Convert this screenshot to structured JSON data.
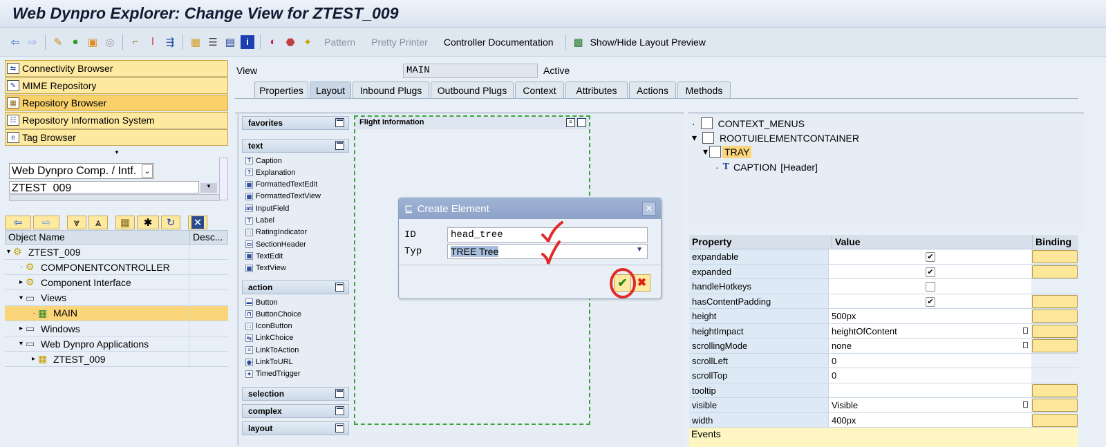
{
  "window": {
    "title": "Web Dynpro Explorer: Change View for ZTEST_009"
  },
  "toolbar": {
    "pattern": "Pattern",
    "pretty_printer": "Pretty Printer",
    "controller_doc": "Controller Documentation",
    "layout_preview": "Show/Hide Layout Preview"
  },
  "nav": {
    "items": [
      "Connectivity Browser",
      "MIME Repository",
      "Repository Browser",
      "Repository Information System",
      "Tag Browser"
    ]
  },
  "object_select": {
    "type": "Web Dynpro Comp. / Intf.",
    "name": "ZTEST_009"
  },
  "tree": {
    "col_name": "Object Name",
    "col_desc": "Desc...",
    "rows": [
      {
        "label": "ZTEST_009",
        "level": 0
      },
      {
        "label": "COMPONENTCONTROLLER",
        "level": 1
      },
      {
        "label": "Component Interface",
        "level": 1
      },
      {
        "label": "Views",
        "level": 1
      },
      {
        "label": "MAIN",
        "level": 2
      },
      {
        "label": "Windows",
        "level": 1
      },
      {
        "label": "Web Dynpro Applications",
        "level": 1
      },
      {
        "label": "ZTEST_009",
        "level": 2
      }
    ]
  },
  "view": {
    "label": "View",
    "name": "MAIN",
    "status": "Active"
  },
  "tabs": [
    "Properties",
    "Layout",
    "Inbound Plugs",
    "Outbound Plugs",
    "Context",
    "Attributes",
    "Actions",
    "Methods"
  ],
  "palette": {
    "groups": {
      "favorites": "favorites",
      "text": "text",
      "action": "action",
      "selection": "selection",
      "complex": "complex",
      "layout": "layout"
    },
    "text_items": [
      "Caption",
      "Explanation",
      "FormattedTextEdit",
      "FormattedTextView",
      "InputField",
      "Label",
      "RatingIndicator",
      "SectionHeader",
      "TextEdit",
      "TextView"
    ],
    "action_items": [
      "Button",
      "ButtonChoice",
      "IconButton",
      "LinkChoice",
      "LinkToAction",
      "LinkToURL",
      "TimedTrigger"
    ]
  },
  "canvas": {
    "container_title": "Flight Information"
  },
  "element_tree": {
    "items": [
      "CONTEXT_MENUS",
      "ROOTUIELEMENTCONTAINER",
      "TRAY",
      "CAPTION",
      "[Header]"
    ]
  },
  "props": {
    "h_property": "Property",
    "h_value": "Value",
    "h_binding": "Binding",
    "events": "Events",
    "rows": [
      {
        "name": "expandable",
        "value": "",
        "checkbox": true,
        "checked": true,
        "binding": true
      },
      {
        "name": "expanded",
        "value": "",
        "checkbox": true,
        "checked": true,
        "binding": true
      },
      {
        "name": "handleHotkeys",
        "value": "",
        "checkbox": true,
        "checked": false,
        "binding": false
      },
      {
        "name": "hasContentPadding",
        "value": "",
        "checkbox": true,
        "checked": true,
        "binding": true
      },
      {
        "name": "height",
        "value": "500px",
        "binding": true
      },
      {
        "name": "heightImpact",
        "value": "heightOfContent",
        "dropdown": true,
        "binding": true
      },
      {
        "name": "scrollingMode",
        "value": "none",
        "dropdown": true,
        "binding": true
      },
      {
        "name": "scrollLeft",
        "value": "0",
        "binding": false
      },
      {
        "name": "scrollTop",
        "value": "0",
        "binding": false
      },
      {
        "name": "tooltip",
        "value": "",
        "binding": true
      },
      {
        "name": "visible",
        "value": "Visible",
        "dropdown": true,
        "binding": true
      },
      {
        "name": "width",
        "value": "400px",
        "binding": true
      }
    ]
  },
  "dialog": {
    "title": "Create Element",
    "id_label": "ID",
    "id_value": "head_tree",
    "typ_label": "Typ",
    "typ_value": "TREE Tree"
  }
}
